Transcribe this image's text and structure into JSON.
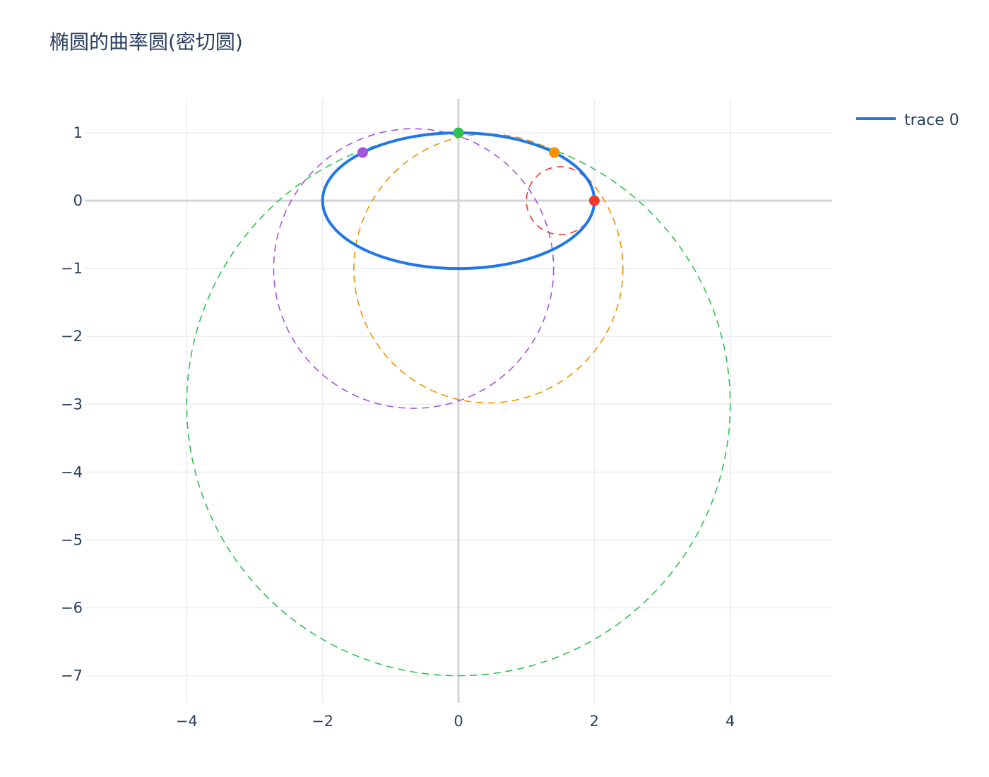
{
  "chart_data": {
    "type": "line",
    "title": "椭圆的曲率圆(密切圆)",
    "xlabel": "",
    "ylabel": "",
    "xlim": [
      -5.5,
      5.5
    ],
    "ylim": [
      -7.4,
      1.5
    ],
    "x_ticks": [
      -4,
      -2,
      0,
      2,
      4
    ],
    "y_ticks": [
      1,
      0,
      -1,
      -2,
      -3,
      -4,
      -5,
      -6,
      -7
    ],
    "grid": true,
    "legend": {
      "position": "top-right",
      "entries": [
        "trace 0"
      ]
    },
    "ellipse": {
      "name": "trace 0",
      "a": 2,
      "b": 1,
      "color": "#1f77e8"
    },
    "curvature_circles": [
      {
        "center": [
          1.5,
          0
        ],
        "radius": 0.5,
        "color": "#ef3b2c"
      },
      {
        "center": [
          0.44,
          -1.0
        ],
        "radius": 1.98,
        "color": "#f39200"
      },
      {
        "center": [
          0,
          -3
        ],
        "radius": 4,
        "color": "#2fc253"
      },
      {
        "center": [
          -0.66,
          -1.0
        ],
        "radius": 2.06,
        "color": "#a455d9"
      }
    ],
    "points": [
      {
        "x": 2,
        "y": 0,
        "color": "#ef3b2c"
      },
      {
        "x": 1.41,
        "y": 0.71,
        "color": "#f39200"
      },
      {
        "x": 0,
        "y": 1,
        "color": "#2fc253"
      },
      {
        "x": -1.41,
        "y": 0.71,
        "color": "#a455d9"
      }
    ]
  }
}
